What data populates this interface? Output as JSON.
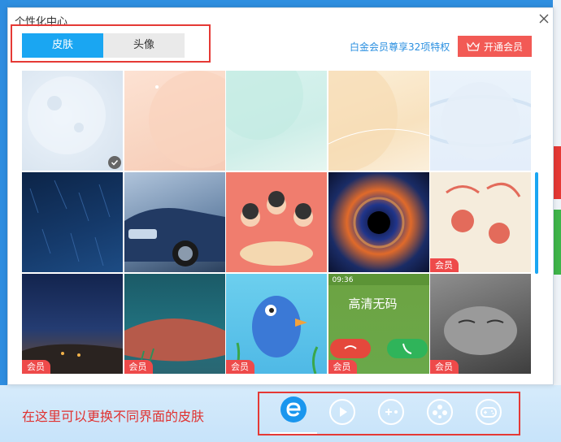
{
  "dialog": {
    "title": "个性化中心",
    "tabs": [
      {
        "label": "皮肤",
        "active": true
      },
      {
        "label": "头像",
        "active": false
      }
    ],
    "privilege_text": "白金会员尊享32项特权",
    "vip_button": "开通会员",
    "accent": "#1aa6f2",
    "vip_color": "#f25a55"
  },
  "skins": [
    {
      "badge": "",
      "selected": true
    },
    {
      "badge": ""
    },
    {
      "badge": ""
    },
    {
      "badge": ""
    },
    {
      "badge": ""
    },
    {
      "badge": ""
    },
    {
      "badge": ""
    },
    {
      "badge": ""
    },
    {
      "badge": ""
    },
    {
      "badge": "会员"
    },
    {
      "badge": "会员"
    },
    {
      "badge": "会员"
    },
    {
      "badge": "会员"
    },
    {
      "badge": "会员",
      "phone_time": "09:36",
      "phone_text": "高清无码"
    },
    {
      "badge": "会员"
    }
  ],
  "annotation": "在这里可以更换不同界面的皮肤",
  "bottom_icons": [
    "browser-e-icon",
    "play-icon",
    "plus-circle-icon",
    "clover-icon",
    "gamepad-icon"
  ]
}
